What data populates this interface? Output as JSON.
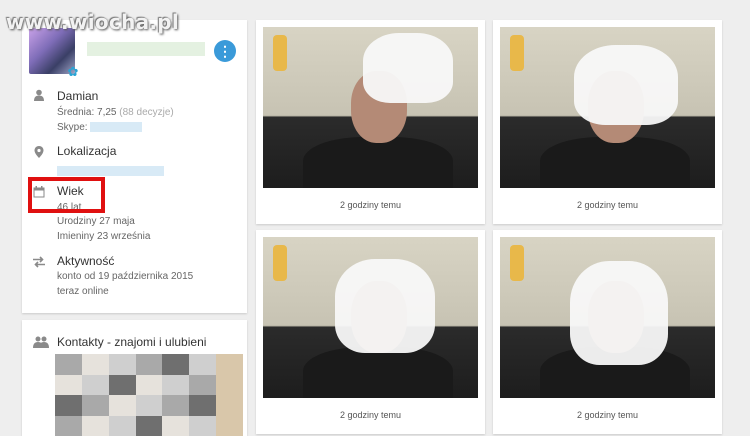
{
  "watermark": "www.wiocha.pl",
  "profile": {
    "name": "Damian",
    "rating_prefix": "Średnia: 7,25",
    "rating_count": "(88 decyzje)",
    "skype_label": "Skype:",
    "location_title": "Lokalizacja",
    "age_title": "Wiek",
    "age_value": "46 lat",
    "birthday": "Urodziny 27 maja",
    "nameday": "Imieniny 23 września",
    "activity_title": "Aktywność",
    "account_since": "konto od 19 października 2015",
    "online_status": "teraz online"
  },
  "contacts": {
    "title": "Kontakty - znajomi i ulubieni"
  },
  "photos": [
    {
      "caption": "2 godziny temu"
    },
    {
      "caption": "2 godziny temu"
    },
    {
      "caption": "2 godziny temu"
    },
    {
      "caption": "2 godziny temu"
    }
  ],
  "icons": {
    "more": "vertical-dots",
    "person": "person-icon",
    "location": "pin-icon",
    "calendar": "calendar-icon",
    "activity": "swap-arrows-icon",
    "contacts": "people-icon"
  },
  "colors": {
    "accent": "#3a9ad9",
    "highlight": "#e01010"
  }
}
